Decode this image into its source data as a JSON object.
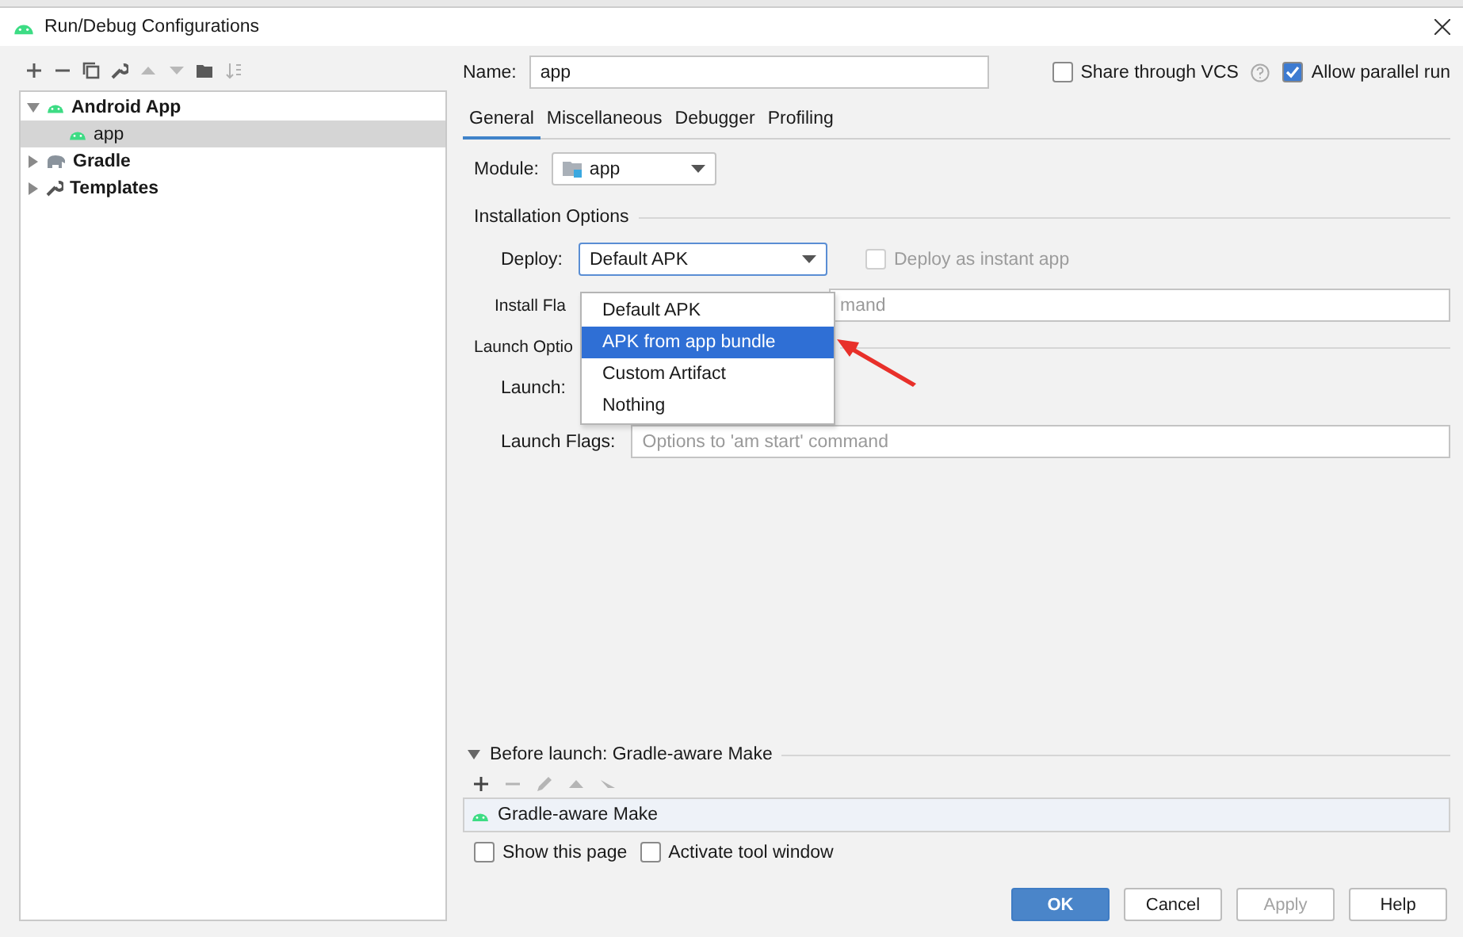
{
  "window": {
    "title": "Run/Debug Configurations"
  },
  "tree": [
    {
      "label": "Android App",
      "kind": "android",
      "expanded": true,
      "selected": false,
      "children": [
        {
          "label": "app",
          "kind": "android",
          "selected": true
        }
      ]
    },
    {
      "label": "Gradle",
      "kind": "gradle",
      "expanded": false,
      "selected": false
    },
    {
      "label": "Templates",
      "kind": "wrench",
      "expanded": false,
      "selected": false
    }
  ],
  "name": {
    "label": "Name:",
    "value": "app"
  },
  "share": {
    "label": "Share through VCS",
    "checked": false
  },
  "allow_parallel": {
    "label": "Allow parallel run",
    "checked": true
  },
  "tabs": [
    {
      "label": "General",
      "selected": true
    },
    {
      "label": "Miscellaneous",
      "selected": false
    },
    {
      "label": "Debugger",
      "selected": false
    },
    {
      "label": "Profiling",
      "selected": false
    }
  ],
  "module": {
    "label": "Module:",
    "value": "app"
  },
  "installation": {
    "title": "Installation Options",
    "deploy": {
      "label": "Deploy:",
      "value": "Default APK"
    },
    "instant": {
      "label": "Deploy as instant app",
      "checked": false,
      "disabled": true
    },
    "install_flags": {
      "label": "Install Fla",
      "placeholder": "mand"
    }
  },
  "deploy_menu": [
    {
      "label": "Default APK",
      "selected": false
    },
    {
      "label": "APK from app bundle",
      "selected": true
    },
    {
      "label": "Custom Artifact",
      "selected": false
    },
    {
      "label": "Nothing",
      "selected": false
    }
  ],
  "launch": {
    "title": "Launch Optio",
    "launch_label": "Launch:",
    "flags": {
      "label": "Launch Flags:",
      "placeholder": "Options to 'am start' command"
    }
  },
  "before_launch": {
    "title": "Before launch: Gradle-aware Make",
    "expanded": true,
    "tasks": [
      "Gradle-aware Make"
    ],
    "show_page": {
      "label": "Show this page",
      "checked": false
    },
    "activate": {
      "label": "Activate tool window",
      "checked": false
    }
  },
  "buttons": [
    {
      "label": "OK",
      "kind": "primary"
    },
    {
      "label": "Cancel",
      "kind": "normal"
    },
    {
      "label": "Apply",
      "kind": "disabled"
    },
    {
      "label": "Help",
      "kind": "normal"
    }
  ]
}
